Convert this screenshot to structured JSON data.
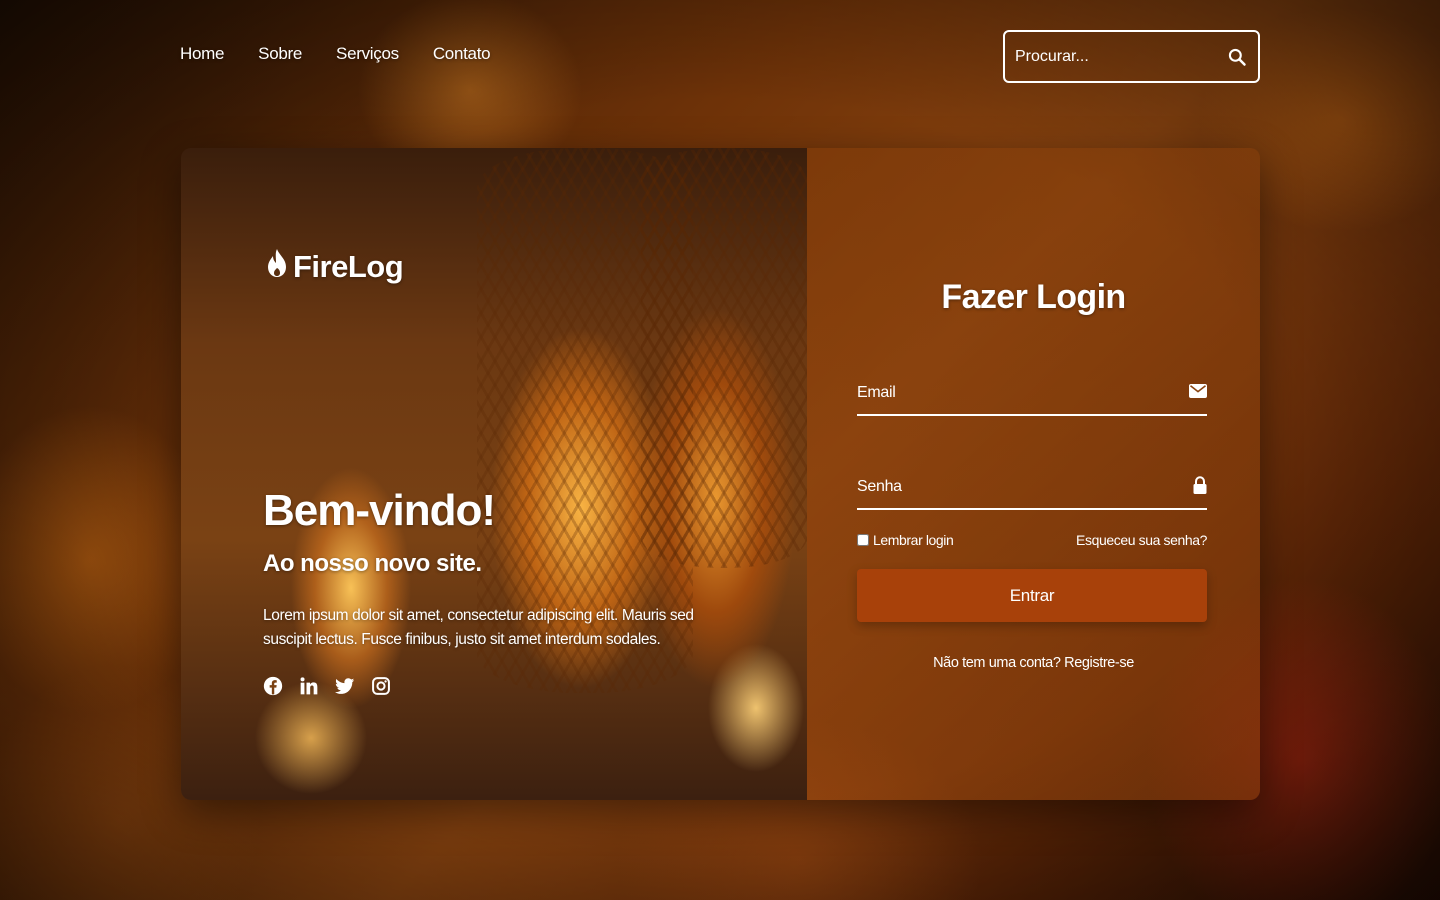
{
  "nav": {
    "items": [
      "Home",
      "Sobre",
      "Serviços",
      "Contato"
    ]
  },
  "search": {
    "placeholder": "Procurar...",
    "icon": "search-icon"
  },
  "hero": {
    "logo_text": "FireLog",
    "logo_icon": "flame-icon",
    "welcome": "Bem-vindo!",
    "subtitle": "Ao nosso novo site.",
    "description": "Lorem ipsum dolor sit amet, consectetur adipiscing elit. Mauris sed suscipit lectus. Fusce finibus, justo sit amet interdum sodales.",
    "social_icons": [
      "facebook-icon",
      "linkedin-icon",
      "twitter-icon",
      "instagram-icon"
    ]
  },
  "login": {
    "title": "Fazer Login",
    "email_placeholder": "Email",
    "email_icon": "envelope-icon",
    "password_placeholder": "Senha",
    "password_icon": "lock-icon",
    "remember_label": "Lembrar login",
    "forgot_label": "Esqueceu sua senha?",
    "submit_label": "Entrar",
    "register_prompt": "Não tem uma conta?",
    "register_link": "Registre-se"
  },
  "colors": {
    "accent": "#a8410a",
    "text": "#ffffff"
  }
}
